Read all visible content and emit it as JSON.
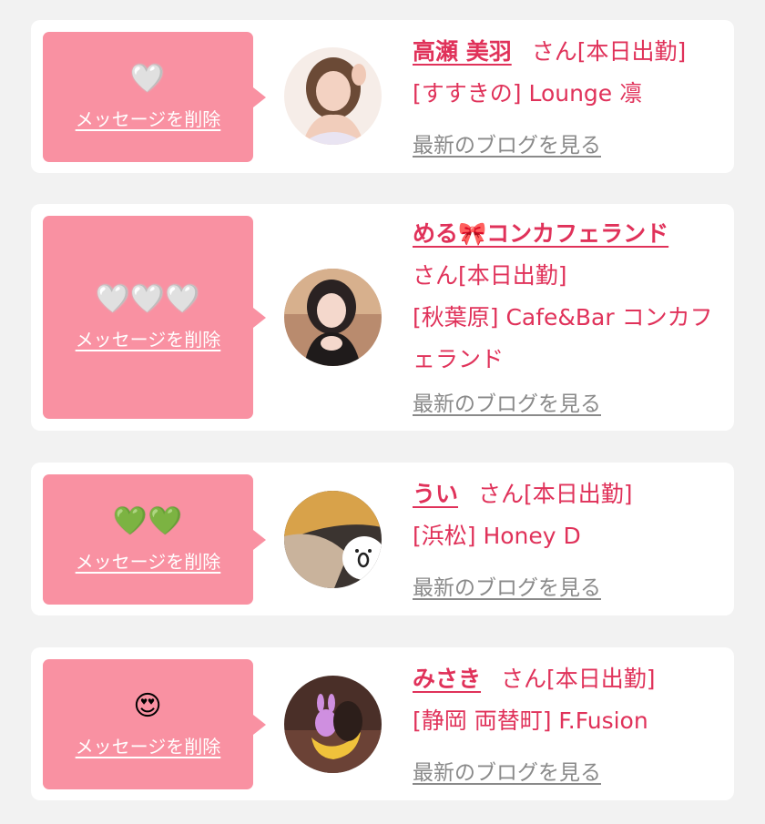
{
  "entries": [
    {
      "reaction": "🤍",
      "delete_label": "メッセージを削除",
      "name": "高瀬 美羽",
      "suffix": "さん[本日出勤]",
      "shop": "[すすきの] Lounge 凛",
      "blog_label": "最新のブログを見る"
    },
    {
      "reaction": "🤍🤍🤍",
      "delete_label": "メッセージを削除",
      "name": "める🎀コンカフェランド",
      "suffix": "さん[本日出勤]",
      "shop": "[秋葉原] Cafe&Bar コンカフェランド",
      "blog_label": "最新のブログを見る"
    },
    {
      "reaction": "💚💚",
      "delete_label": "メッセージを削除",
      "name": "うい",
      "suffix": "さん[本日出勤]",
      "shop": "[浜松] Honey D",
      "blog_label": "最新のブログを見る"
    },
    {
      "reaction": "😍",
      "delete_label": "メッセージを削除",
      "name": "みさき",
      "suffix": "さん[本日出勤]",
      "shop": "[静岡 両替町] F.Fusion",
      "blog_label": "最新のブログを見る"
    }
  ],
  "colors": {
    "bubble": "#f991a2",
    "name_text": "#e0325a",
    "link_gray": "#8a8a8a",
    "card_bg": "#ffffff",
    "page_bg": "#f2f2f2"
  }
}
